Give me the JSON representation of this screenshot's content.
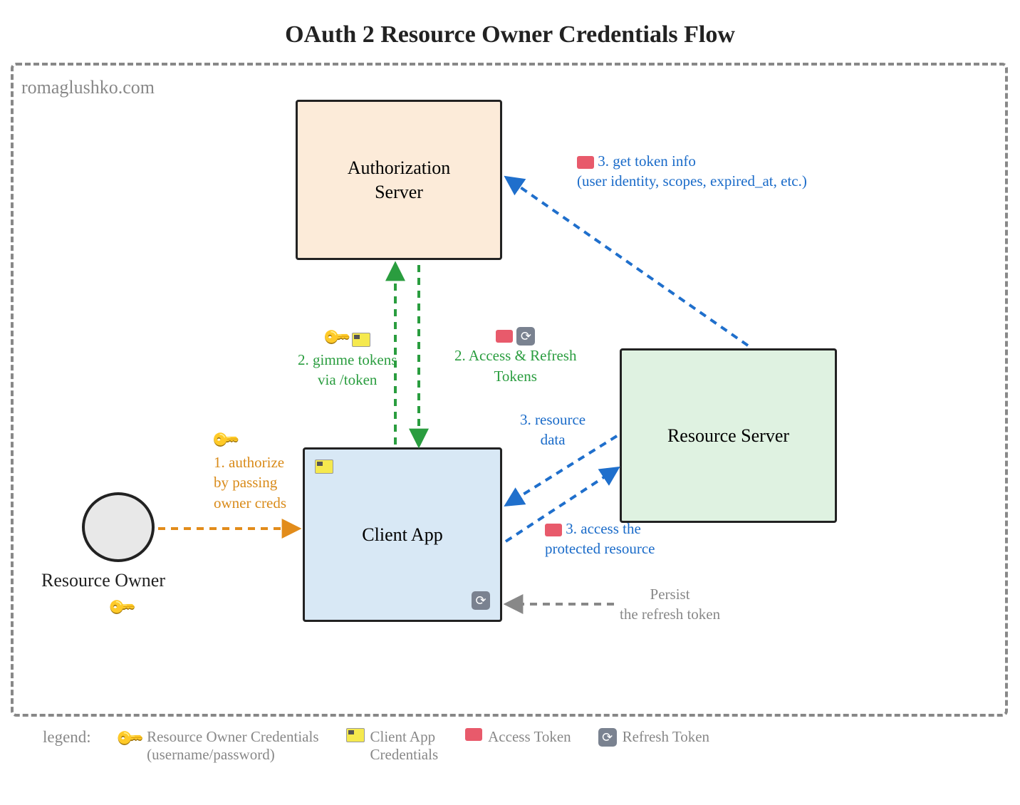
{
  "title": "OAuth 2 Resource Owner Credentials Flow",
  "watermark": "romaglushko.com",
  "nodes": {
    "auth_server": "Authorization\nServer",
    "client_app": "Client App",
    "resource_server": "Resource Server",
    "resource_owner": "Resource Owner"
  },
  "steps": {
    "step1": "1. authorize\nby passing\nowner creds",
    "step2a": "2. gimme tokens\nvia /token",
    "step2b": "2. Access & Refresh\nTokens",
    "step3a": "3. get token info\n(user identity, scopes, expired_at, etc.)",
    "step3b": "3. resource\ndata",
    "step3c": "3. access the\nprotected resource",
    "persist": "Persist\nthe refresh token"
  },
  "legend": {
    "title": "legend:",
    "owner_creds": "Resource Owner Credentials\n(username/password)",
    "client_creds": "Client App\nCredentials",
    "access_token": "Access Token",
    "refresh_token": "Refresh Token"
  },
  "colors": {
    "orange": "#E28C1B",
    "green": "#2A9D3F",
    "blue": "#1F6FCC",
    "gray": "#888888"
  }
}
